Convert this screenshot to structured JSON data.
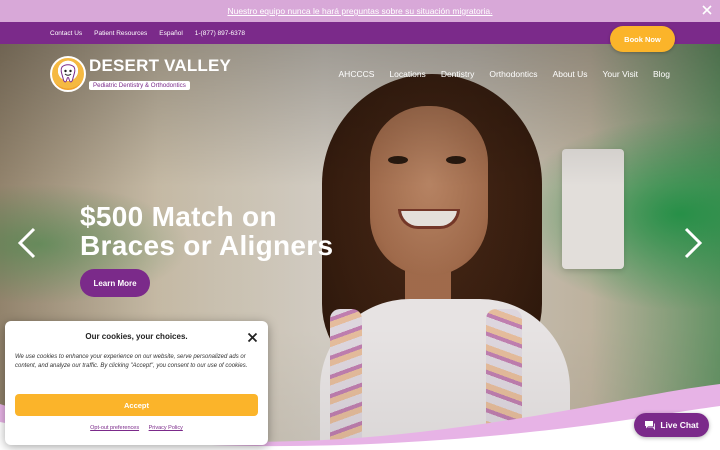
{
  "announcement": {
    "text": "Nuestro equipo nunca le hará preguntas sobre su situación migratoria."
  },
  "utility_nav": {
    "items": [
      "Contact Us",
      "Patient Resources",
      "Español",
      "1-(877) 897-6378"
    ]
  },
  "book_button": {
    "label": "Book Now"
  },
  "logo": {
    "name": "DESERT VALLEY",
    "tagline": "Pediatric Dentistry & Orthodontics"
  },
  "main_nav": {
    "items": [
      "AHCCCS",
      "Locations",
      "Dentistry",
      "Orthodontics",
      "About Us",
      "Your Visit",
      "Blog"
    ]
  },
  "hero": {
    "headline_line1": "$500 Match on",
    "headline_line2": "Braces or Aligners",
    "cta_label": "Learn More"
  },
  "cookie": {
    "title": "Our cookies, your choices.",
    "body": "We use cookies to enhance your experience on our website, serve personalized ads or content, and analyze our traffic. By clicking \"Accept\", you consent to our use of cookies.",
    "accept_label": "Accept",
    "optout_label": "Opt-out preferences",
    "privacy_label": "Privacy Policy"
  },
  "chat": {
    "label": "Live Chat"
  },
  "colors": {
    "purple": "#7b2a8a",
    "light_purple": "#d8a8d8",
    "accent_yellow": "#fbb42a",
    "wave_pink": "#e7b3e6"
  },
  "icons": [
    "close-icon",
    "tooth-logo-icon",
    "chevron-left-icon",
    "chevron-right-icon",
    "chat-bubble-icon"
  ]
}
